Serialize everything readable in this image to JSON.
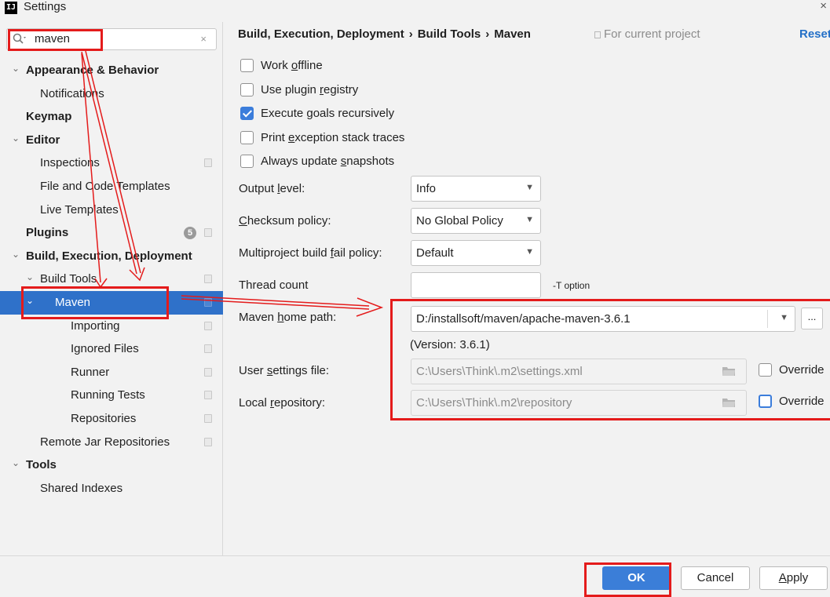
{
  "window": {
    "title": "Settings",
    "app_icon": "intellij-icon",
    "close_glyph": "×"
  },
  "search": {
    "value": "maven",
    "clear_glyph": "×"
  },
  "tree": [
    {
      "label": "Appearance & Behavior",
      "bold": true,
      "expanded": true,
      "level": 0
    },
    {
      "label": "Notifications",
      "level": 1
    },
    {
      "label": "Keymap",
      "bold": true,
      "level": 0
    },
    {
      "label": "Editor",
      "bold": true,
      "expanded": true,
      "level": 0
    },
    {
      "label": "Inspections",
      "level": 1,
      "project_icon": true
    },
    {
      "label": "File and Code Templates",
      "level": 1
    },
    {
      "label": "Live Templates",
      "level": 1
    },
    {
      "label": "Plugins",
      "bold": true,
      "level": 0,
      "badge": "5",
      "project_icon": true
    },
    {
      "label": "Build, Execution, Deployment",
      "bold": true,
      "expanded": true,
      "level": 0
    },
    {
      "label": "Build Tools",
      "expanded": true,
      "level": 1,
      "project_icon": true
    },
    {
      "label": "Maven",
      "expanded": true,
      "level": 2,
      "selected": true,
      "project_icon": true
    },
    {
      "label": "Importing",
      "level": 3,
      "project_icon": true
    },
    {
      "label": "Ignored Files",
      "level": 3,
      "project_icon": true
    },
    {
      "label": "Runner",
      "level": 3,
      "project_icon": true
    },
    {
      "label": "Running Tests",
      "level": 3,
      "project_icon": true
    },
    {
      "label": "Repositories",
      "level": 3,
      "project_icon": true
    },
    {
      "label": "Remote Jar Repositories",
      "level": 1,
      "project_icon": true
    },
    {
      "label": "Tools",
      "bold": true,
      "expanded": true,
      "level": 0
    },
    {
      "label": "Shared Indexes",
      "level": 1
    }
  ],
  "breadcrumb": {
    "part1": "Build, Execution, Deployment",
    "part2": "Build Tools",
    "part3": "Maven",
    "separator": "›"
  },
  "scope_label": "For current project",
  "reset_label": "Reset",
  "checkboxes": {
    "work_offline": {
      "pre": "Work ",
      "mn": "o",
      "post": "ffline",
      "checked": false
    },
    "plugin_registry": {
      "pre": "Use plugin ",
      "mn": "r",
      "post": "egistry",
      "checked": false
    },
    "execute_recursively": {
      "pre": "Execute ",
      "mn": "g",
      "post": "oals recursively",
      "checked": true
    },
    "print_stack": {
      "pre": "Print ",
      "mn": "e",
      "post": "xception stack traces",
      "checked": false
    },
    "update_snapshots": {
      "pre": "Always update ",
      "mn": "s",
      "post": "napshots",
      "checked": false
    }
  },
  "form": {
    "output_level": {
      "pre": "Output ",
      "mn": "l",
      "post": "evel:",
      "value": "Info"
    },
    "checksum_policy": {
      "pre": "",
      "mn": "C",
      "post": "hecksum policy:",
      "value": "No Global Policy"
    },
    "fail_policy": {
      "pre": "Multiproject build ",
      "mn": "f",
      "post": "ail policy:",
      "value": "Default"
    },
    "thread_count": {
      "label": "Thread count",
      "value": "",
      "note": "-T option"
    },
    "maven_home": {
      "pre": "Maven ",
      "mn": "h",
      "post": "ome path:",
      "value": "D:/installsoft/maven/apache-maven-3.6.1",
      "version": "(Version: 3.6.1)",
      "browse": "..."
    },
    "user_settings": {
      "pre": "User ",
      "mn": "s",
      "post": "ettings file:",
      "value": "C:\\Users\\Think\\.m2\\settings.xml",
      "override": "Override"
    },
    "local_repo": {
      "pre": "Local ",
      "mn": "r",
      "post": "epository:",
      "value": "C:\\Users\\Think\\.m2\\repository",
      "override": "Override"
    }
  },
  "buttons": {
    "help": "?",
    "ok": "OK",
    "cancel": "Cancel",
    "apply_mn": "A",
    "apply_rest": "pply"
  },
  "colors": {
    "selection": "#2f71c9",
    "accent": "#3b7ed8",
    "annotation": "#e41b1b",
    "link": "#2470c7"
  }
}
